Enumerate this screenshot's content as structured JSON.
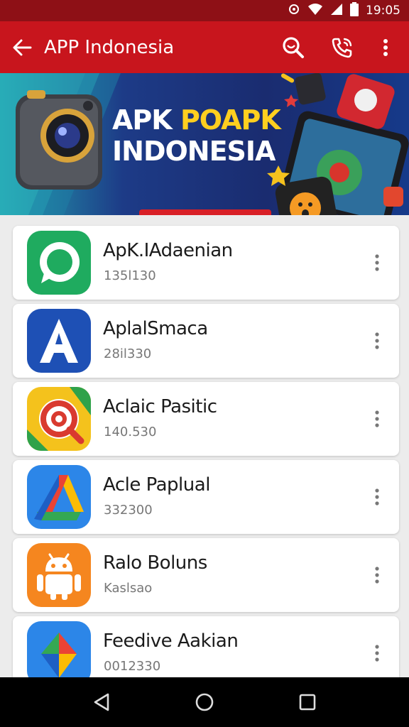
{
  "status": {
    "time": "19:05"
  },
  "app_bar": {
    "title": "APP Indonesia"
  },
  "banner": {
    "line1_white": "APK ",
    "line1_yellow": "POAPK",
    "line2": "INDONESIA"
  },
  "apps": [
    {
      "name": "ApK.IAdaenian",
      "meta": "135l130",
      "icon": "chat-bubble-icon",
      "color": "#1fab5f"
    },
    {
      "name": "AplalSmaca",
      "meta": "28il330",
      "icon": "letter-a-icon",
      "color": "#1e50b5"
    },
    {
      "name": "Aclaic Pasitic",
      "meta": "140.530",
      "icon": "spiral-icon",
      "color": "#f4c21c"
    },
    {
      "name": "Acle Paplual",
      "meta": "332300",
      "icon": "drive-triangle-icon",
      "color": "#2c86e8"
    },
    {
      "name": "Ralo Boluns",
      "meta": "Kaslsao",
      "icon": "android-icon",
      "color": "#f5861f"
    },
    {
      "name": "Feedive Aakian",
      "meta": "0012330",
      "icon": "diamond-icon",
      "color": "#2c86e8"
    }
  ]
}
